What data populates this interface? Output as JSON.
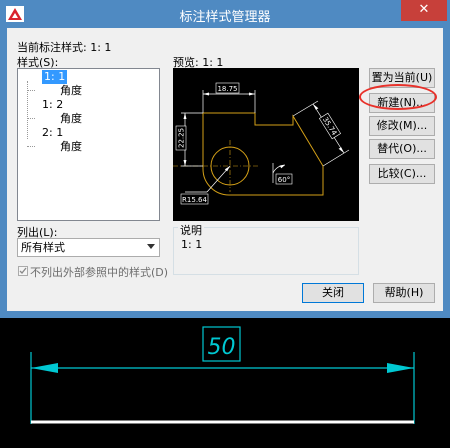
{
  "window": {
    "title": "标注样式管理器",
    "close_glyph": "✕"
  },
  "current_style": {
    "label": "当前标注样式: 1: 1"
  },
  "styles": {
    "label": "样式(S):",
    "tree": [
      {
        "label": "1: 1",
        "level": 0,
        "selected": true
      },
      {
        "label": "角度",
        "level": 1
      },
      {
        "label": "1: 2",
        "level": 0
      },
      {
        "label": "角度",
        "level": 1
      },
      {
        "label": "2: 1",
        "level": 0
      },
      {
        "label": "角度",
        "level": 1
      }
    ]
  },
  "preview": {
    "label": "预览: 1: 1",
    "dims": {
      "top": "18.75",
      "left": "22.25",
      "right": "35.74",
      "angle": "60°",
      "radius": "R15.64"
    }
  },
  "list_filter": {
    "label": "列出(L):",
    "selected": "所有样式"
  },
  "exclude_xref": {
    "label": "不列出外部参照中的样式(D)",
    "checked": true,
    "disabled": true
  },
  "description": {
    "legend": "说明",
    "text": "1: 1"
  },
  "buttons": {
    "set_current": "置为当前(U)",
    "new": "新建(N)...",
    "modify": "修改(M)...",
    "override": "替代(O)...",
    "compare": "比较(C)...",
    "close": "关闭",
    "help": "帮助(H)"
  },
  "cad_dimension": {
    "value": "50"
  },
  "colors": {
    "titlebar": "#4f8ac2",
    "close": "#c7403a",
    "highlight": "#e8312a",
    "cad_dim": "#00c8d2",
    "preview_geometry": "#d4a017"
  }
}
